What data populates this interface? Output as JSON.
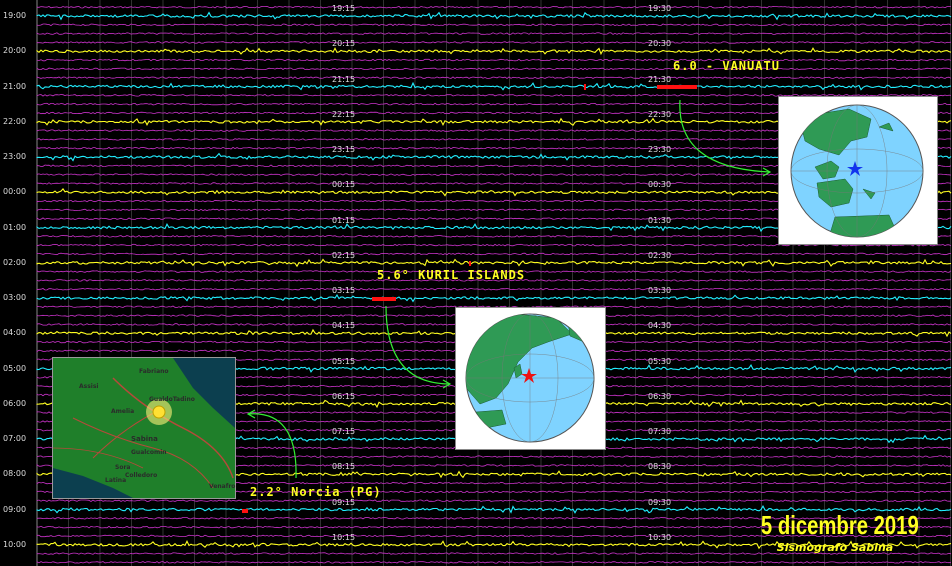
{
  "hour_labels": [
    "19:00",
    "20:00",
    "21:00",
    "22:00",
    "23:00",
    "00:00",
    "01:00",
    "02:00",
    "03:00",
    "04:00",
    "05:00",
    "06:00",
    "07:00",
    "08:00",
    "09:00",
    "10:00"
  ],
  "mid_labels_a": [
    "19:15",
    "20:15",
    "21:15",
    "22:15",
    "23:15",
    "00:15",
    "01:15",
    "02:15",
    "03:15",
    "04:15",
    "05:15",
    "06:15",
    "07:15",
    "08:15",
    "09:15",
    "10:15"
  ],
  "mid_labels_b": [
    "19:30",
    "20:30",
    "21:30",
    "22:30",
    "23:30",
    "00:30",
    "01:30",
    "02:30",
    "03:30",
    "04:30",
    "05:30",
    "06:30",
    "07:30",
    "08:30",
    "09:30",
    "10:30"
  ],
  "events": {
    "vanuatu": "6.0 - VANUATU",
    "kuril": "5.6° KURIL ISLANDS",
    "norcia": "2.2° Norcia (PG)"
  },
  "map_labels": {
    "fabriano": "Fabriano",
    "assisi": "Assisi",
    "gualdo": "GualdoTadino",
    "sabina": "Sabina",
    "gualcomin": "Gualcomin",
    "venafro": "Venafro",
    "arcelle": "Amelia",
    "sdm": "Sora",
    "colledoro": "Colledoro",
    "latina": "Latina"
  },
  "footer": {
    "date": "5 dicembre 2019",
    "station": "Sismografo Sabina"
  },
  "colors": {
    "trace_cyan": "#22eeff",
    "trace_yellow": "#ffff22",
    "trace_magenta": "#cc33cc",
    "grid": "#555555",
    "event_red": "#ff1111",
    "arrow_green": "#33ee33",
    "ocean": "#66ccff",
    "land": "#339955"
  }
}
